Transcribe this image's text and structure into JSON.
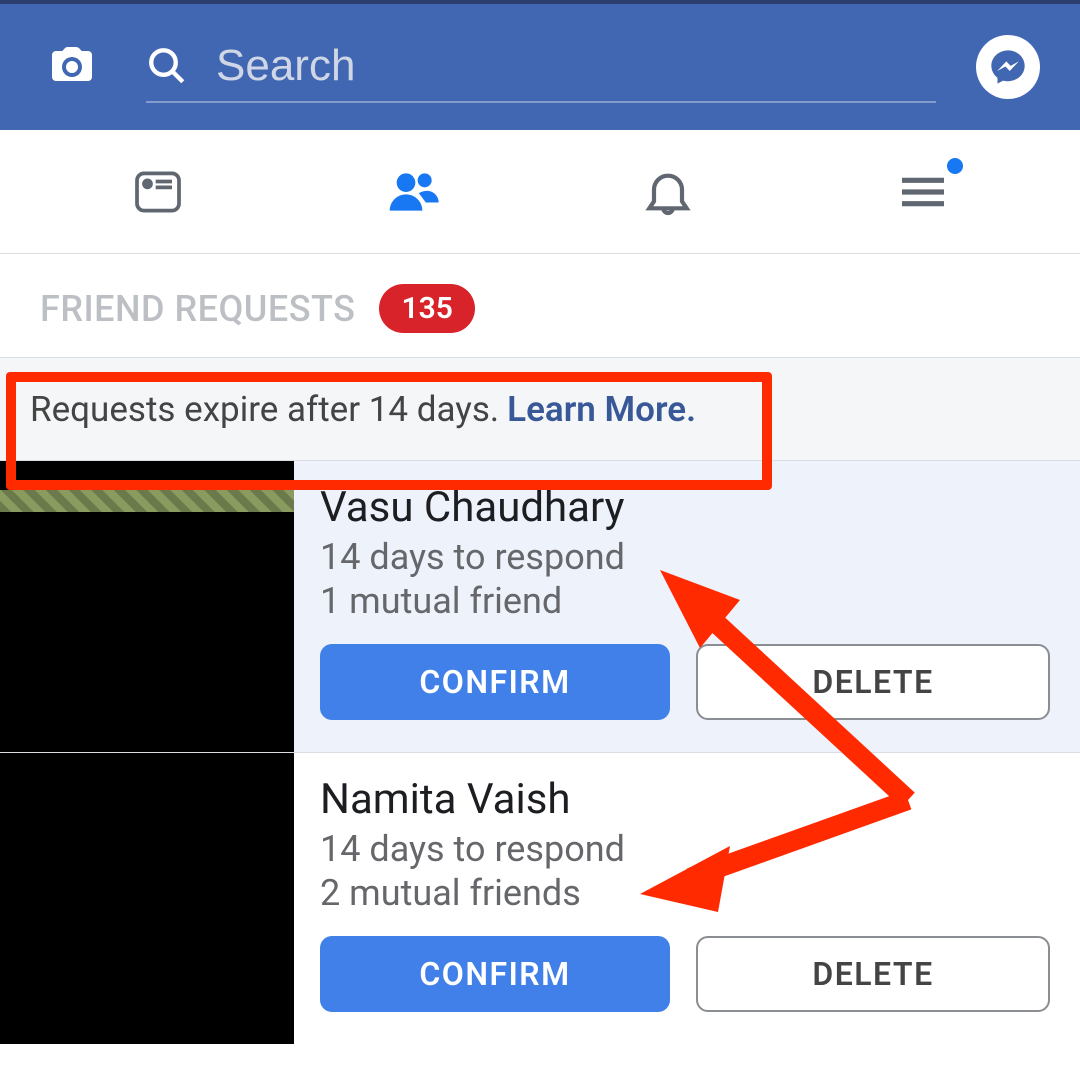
{
  "header": {
    "search_placeholder": "Search"
  },
  "section": {
    "title": "FRIEND REQUESTS",
    "badge_count": "135"
  },
  "banner": {
    "text": "Requests expire after 14 days.",
    "learn_more": "Learn More."
  },
  "requests": [
    {
      "name": "Vasu Chaudhary",
      "days": "14 days to respond",
      "mutual": "1 mutual friend",
      "confirm_label": "CONFIRM",
      "delete_label": "DELETE"
    },
    {
      "name": "Namita Vaish",
      "days": "14 days to respond",
      "mutual": "2 mutual friends",
      "confirm_label": "CONFIRM",
      "delete_label": "DELETE"
    }
  ]
}
